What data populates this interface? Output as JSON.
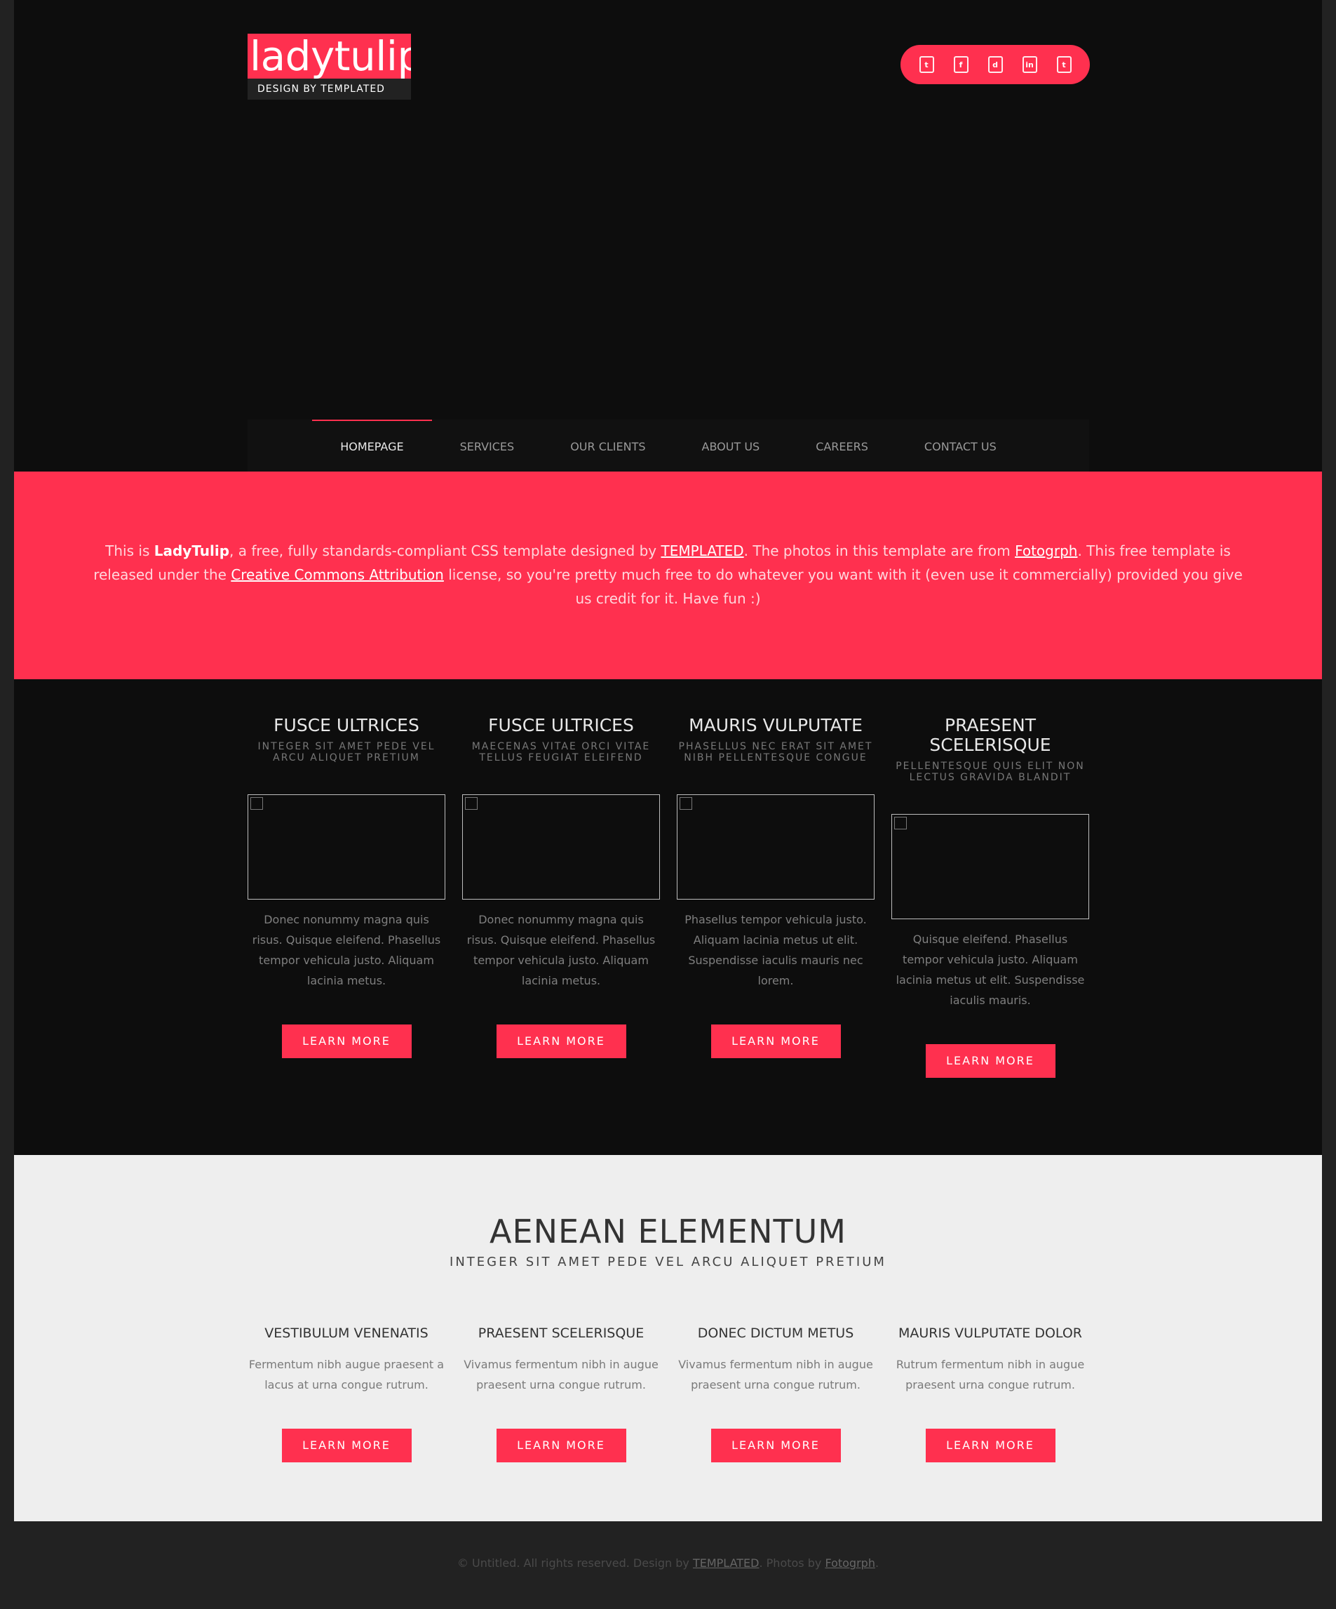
{
  "logo": {
    "title": "ladytulip",
    "subtitle": "DESIGN BY TEMPLATED"
  },
  "social": [
    "twitter-icon",
    "facebook-icon",
    "dribbble-icon",
    "linkedin-icon",
    "tumblr-icon"
  ],
  "nav": {
    "items": [
      {
        "label": "HOMEPAGE"
      },
      {
        "label": "SERVICES"
      },
      {
        "label": "OUR CLIENTS"
      },
      {
        "label": "ABOUT US"
      },
      {
        "label": "CAREERS"
      },
      {
        "label": "CONTACT US"
      }
    ]
  },
  "banner": {
    "t1": "This is ",
    "brand": "LadyTulip",
    "t2": ", a free, fully standards-compliant CSS template designed by ",
    "link1": "TEMPLATED",
    "t3": ". The photos in this template are from ",
    "link2": "Fotogrph",
    "t4": ". This free template is released under the ",
    "link3": "Creative Commons Attribution",
    "t5": " license, so you're pretty much free to do whatever you want with it (even use it commercially) provided you give us credit for it. Have fun :)"
  },
  "features": [
    {
      "title": "FUSCE ULTRICES",
      "subtitle": "INTEGER SIT AMET PEDE VEL ARCU ALIQUET PRETIUM",
      "text": "Donec nonummy magna quis risus. Quisque eleifend. Phasellus tempor vehicula justo. Aliquam lacinia metus.",
      "button": "LEARN MORE"
    },
    {
      "title": "FUSCE ULTRICES",
      "subtitle": "MAECENAS VITAE ORCI VITAE TELLUS FEUGIAT ELEIFEND",
      "text": "Donec nonummy magna quis risus. Quisque eleifend. Phasellus tempor vehicula justo. Aliquam lacinia metus.",
      "button": "LEARN MORE"
    },
    {
      "title": "MAURIS VULPUTATE",
      "subtitle": "PHASELLUS NEC ERAT SIT AMET NIBH PELLENTESQUE CONGUE",
      "text": "Phasellus tempor vehicula justo. Aliquam lacinia metus ut elit. Suspendisse iaculis mauris nec lorem.",
      "button": "LEARN MORE"
    },
    {
      "title": "PRAESENT SCELERISQUE",
      "subtitle": "PELLENTESQUE QUIS ELIT NON LECTUS GRAVIDA BLANDIT",
      "text": "Quisque eleifend. Phasellus tempor vehicula justo. Aliquam lacinia metus ut elit. Suspendisse iaculis mauris.",
      "button": "LEARN MORE"
    }
  ],
  "section": {
    "title": "AENEAN ELEMENTUM",
    "subtitle": "INTEGER SIT AMET PEDE VEL ARCU ALIQUET PRETIUM",
    "columns": [
      {
        "title": "VESTIBULUM VENENATIS",
        "text": "Fermentum nibh augue praesent a lacus at urna congue rutrum.",
        "button": "LEARN MORE"
      },
      {
        "title": "PRAESENT SCELERISQUE",
        "text": "Vivamus fermentum nibh in augue praesent urna congue rutrum.",
        "button": "LEARN MORE"
      },
      {
        "title": "DONEC DICTUM METUS",
        "text": "Vivamus fermentum nibh in augue praesent urna congue rutrum.",
        "button": "LEARN MORE"
      },
      {
        "title": "MAURIS VULPUTATE DOLOR",
        "text": "Rutrum fermentum nibh in augue praesent urna congue rutrum.",
        "button": "LEARN MORE"
      }
    ]
  },
  "footer": {
    "t1": "© Untitled. All rights reserved. Design by ",
    "link1": "TEMPLATED",
    "t2": ". Photos by ",
    "link2": "Fotogrph",
    "t3": "."
  },
  "colors": {
    "accent": "#ff304f",
    "dark": "#0d0d0d",
    "light": "#eeeeee"
  }
}
